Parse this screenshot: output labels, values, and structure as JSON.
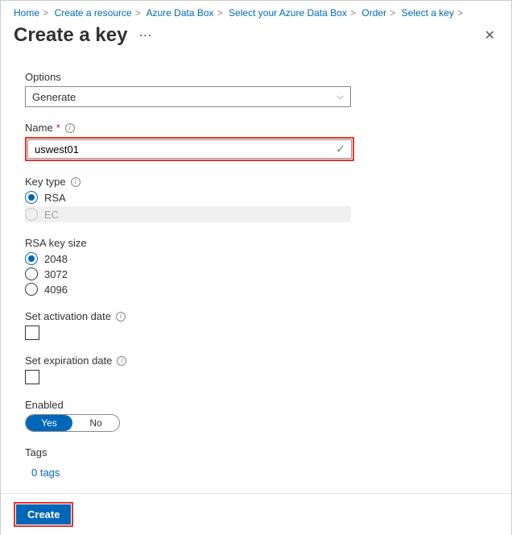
{
  "breadcrumb": [
    "Home",
    "Create a resource",
    "Azure Data Box",
    "Select your Azure Data Box",
    "Order",
    "Select a key"
  ],
  "header": {
    "title": "Create a key"
  },
  "options": {
    "label": "Options",
    "value": "Generate"
  },
  "name": {
    "label": "Name",
    "value": "uswest01"
  },
  "key_type": {
    "label": "Key type",
    "options": [
      "RSA",
      "EC"
    ],
    "selected": "RSA",
    "disabled": [
      "EC"
    ]
  },
  "rsa_size": {
    "label": "RSA key size",
    "options": [
      "2048",
      "3072",
      "4096"
    ],
    "selected": "2048"
  },
  "activation": {
    "label": "Set activation date",
    "checked": false
  },
  "expiration": {
    "label": "Set expiration date",
    "checked": false
  },
  "enabled": {
    "label": "Enabled",
    "yes": "Yes",
    "no": "No",
    "value": true
  },
  "tags": {
    "label": "Tags",
    "link": "0 tags"
  },
  "footer": {
    "create": "Create"
  }
}
